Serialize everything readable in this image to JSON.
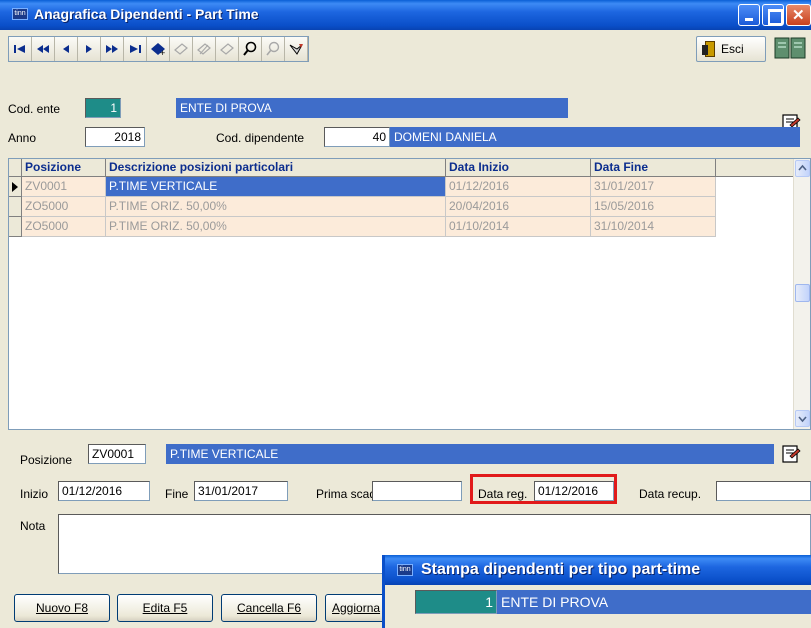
{
  "window": {
    "title": "Anagrafica Dipendenti - Part Time",
    "icon_text": "tinn"
  },
  "toolbar": {
    "nav_icons": [
      "first-icon",
      "prev-page-icon",
      "prev-icon",
      "next-icon",
      "next-page-icon",
      "last-icon",
      "new-record-icon",
      "edit-disabled-icon",
      "edit-disabled-icon",
      "delete-disabled-icon",
      "search-icon",
      "search-disabled-icon",
      "filter-icon"
    ],
    "esci_label": "Esci"
  },
  "header": {
    "cod_ente_label": "Cod. ente",
    "cod_ente_value": "1",
    "ente_name": "ENTE DI PROVA",
    "anno_label": "Anno",
    "anno_value": "2018",
    "cod_dipendente_label": "Cod. dipendente",
    "cod_dipendente_value": "40",
    "dipendente_name": "DOMENI DANIELA"
  },
  "grid": {
    "columns": [
      "Posizione",
      "Descrizione posizioni particolari",
      "Data Inizio",
      "Data Fine"
    ],
    "rows": [
      {
        "posizione": "ZV0001",
        "descrizione": "P.TIME VERTICALE",
        "data_inizio": "01/12/2016",
        "data_fine": "31/01/2017"
      },
      {
        "posizione": "ZO5000",
        "descrizione": "P.TIME ORIZ. 50,00%",
        "data_inizio": "20/04/2016",
        "data_fine": "15/05/2016"
      },
      {
        "posizione": "ZO5000",
        "descrizione": "P.TIME ORIZ. 50,00%",
        "data_inizio": "01/10/2014",
        "data_fine": "31/10/2014"
      }
    ]
  },
  "detail": {
    "posizione_label": "Posizione",
    "posizione_value": "ZV0001",
    "posizione_desc": "P.TIME VERTICALE",
    "inizio_label": "Inizio",
    "inizio_value": "01/12/2016",
    "fine_label": "Fine",
    "fine_value": "31/01/2017",
    "prima_scad_label": "Prima scad",
    "prima_scad_value": "",
    "data_reg_label": "Data reg.",
    "data_reg_value": "01/12/2016",
    "data_recup_label": "Data recup.",
    "data_recup_value": "",
    "nota_label": "Nota",
    "nota_value": ""
  },
  "buttons": {
    "nuovo": "Nuovo F8",
    "edita": "Edita F5",
    "cancella": "Cancella F6",
    "aggiorna": "Aggiorna"
  },
  "dialog": {
    "icon_text": "tinn",
    "title": "Stampa dipendenti per tipo part-time",
    "ente_code": "1",
    "ente_name": "ENTE DI PROVA"
  },
  "colors": {
    "selection_blue": "#3F6DC9",
    "teal": "#1E8C88",
    "row_peach": "#FCEBDA",
    "highlight_red": "#E11A1A"
  }
}
